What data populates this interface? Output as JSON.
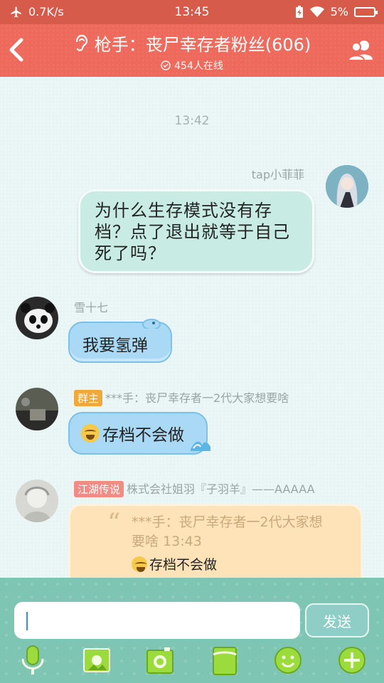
{
  "status_bar": {
    "net_speed": "0.7K/s",
    "time": "13:45",
    "battery": "5%"
  },
  "header": {
    "title": "枪手：丧尸幸存者粉丝(606)",
    "online": "454人在线"
  },
  "chat": {
    "timestamp": "13:42",
    "messages": [
      {
        "sender": "tap小菲菲",
        "text_lines": [
          "为什么生存模式没有存",
          "档？点了退出就等于自己",
          "死了吗？"
        ]
      },
      {
        "sender": "雪十七",
        "text": "我要氢弹"
      },
      {
        "tag": "群主",
        "sender": "***手：丧尸幸存者一2代大家想要啥",
        "text": "存档不会做"
      },
      {
        "tag": "江湖传说",
        "sender": "株式会社姐羽『子羽羊』——AAAAA",
        "quote_lines": [
          "***手：丧尸幸存者一2代大家想",
          "要啥 13:43"
        ],
        "quote_body": "存档不会做"
      }
    ]
  },
  "input": {
    "placeholder": "",
    "send_label": "发送"
  },
  "colors": {
    "header": "#ee6a5c",
    "status": "#d65b4a",
    "input_bar": "#7fc5b3",
    "owner_tag": "#f0a83a",
    "legend_tag": "#f28b84"
  }
}
